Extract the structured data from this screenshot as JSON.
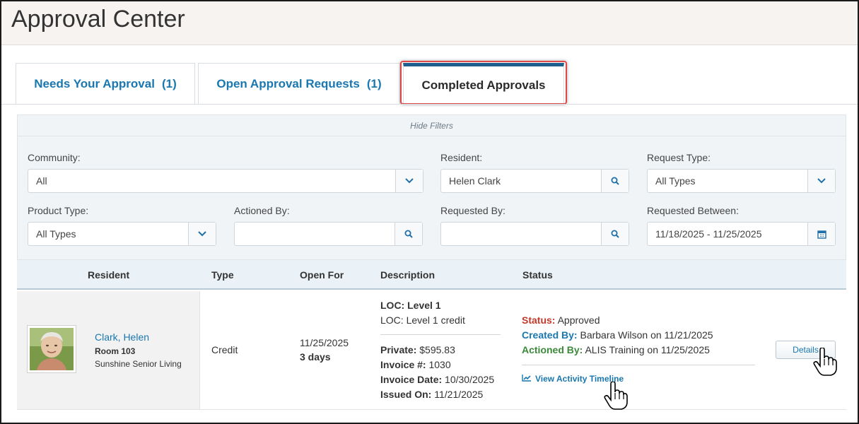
{
  "page_title": "Approval Center",
  "tabs": [
    {
      "label": "Needs Your Approval",
      "count": "(1)"
    },
    {
      "label": "Open Approval Requests",
      "count": "(1)"
    },
    {
      "label": "Completed Approvals",
      "count": ""
    }
  ],
  "active_tab": "Completed Approvals",
  "filters": {
    "toggle_label": "Hide Filters",
    "community": {
      "label": "Community:",
      "value": "All"
    },
    "resident": {
      "label": "Resident:",
      "value": "Helen Clark"
    },
    "request_type": {
      "label": "Request Type:",
      "value": "All Types"
    },
    "product_type": {
      "label": "Product Type:",
      "value": "All Types"
    },
    "actioned_by": {
      "label": "Actioned By:",
      "value": ""
    },
    "requested_by": {
      "label": "Requested By:",
      "value": ""
    },
    "requested_between": {
      "label": "Requested Between:",
      "value": "11/18/2025 - 11/25/2025"
    }
  },
  "table": {
    "columns": [
      "Resident",
      "Type",
      "Open For",
      "Description",
      "Status"
    ],
    "rows": [
      {
        "resident_name": "Clark, Helen",
        "room": "Room 103",
        "community": "Sunshine Senior Living",
        "type": "Credit",
        "open_date": "11/25/2025",
        "open_duration": "3 days",
        "description": {
          "loc_title": "LOC: Level 1",
          "loc_detail": "LOC: Level 1 credit",
          "private_label": "Private:",
          "private_value": "$595.83",
          "invoice_label": "Invoice #:",
          "invoice_value": "1030",
          "invoice_date_label": "Invoice Date:",
          "invoice_date_value": "10/30/2025",
          "issued_label": "Issued On:",
          "issued_value": "11/21/2025"
        },
        "status": {
          "status_label": "Status:",
          "status_value": "Approved",
          "created_label": "Created By:",
          "created_value": "Barbara Wilson on 11/21/2025",
          "actioned_label": "Actioned By:",
          "actioned_value": "ALIS Training on 11/25/2025",
          "timeline_link": "View Activity Timeline"
        },
        "details_button": "Details"
      }
    ]
  },
  "colors": {
    "link_blue": "#1a77b0",
    "status_red": "#c0392b",
    "actioned_green": "#3a8a3a",
    "highlight_red": "#e04848",
    "active_tab_bar": "#1f5f8f"
  },
  "icons": [
    "chevron-down-icon",
    "search-icon",
    "calendar-icon",
    "chart-line-icon",
    "hand-pointer-icon"
  ]
}
